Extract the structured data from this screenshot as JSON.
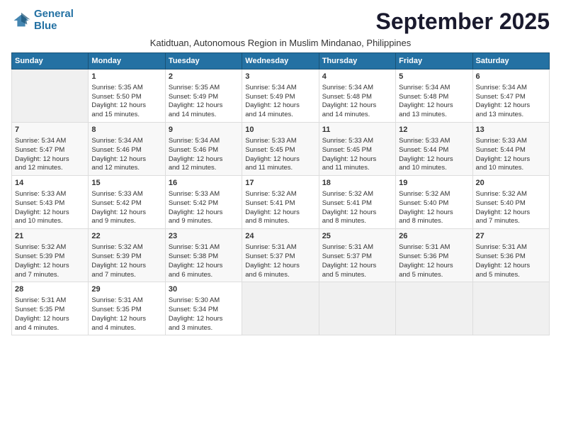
{
  "logo": {
    "line1": "General",
    "line2": "Blue"
  },
  "title": "September 2025",
  "subtitle": "Katidtuan, Autonomous Region in Muslim Mindanao, Philippines",
  "days_header": [
    "Sunday",
    "Monday",
    "Tuesday",
    "Wednesday",
    "Thursday",
    "Friday",
    "Saturday"
  ],
  "weeks": [
    [
      {
        "num": "",
        "info": ""
      },
      {
        "num": "1",
        "info": "Sunrise: 5:35 AM\nSunset: 5:50 PM\nDaylight: 12 hours\nand 15 minutes."
      },
      {
        "num": "2",
        "info": "Sunrise: 5:35 AM\nSunset: 5:49 PM\nDaylight: 12 hours\nand 14 minutes."
      },
      {
        "num": "3",
        "info": "Sunrise: 5:34 AM\nSunset: 5:49 PM\nDaylight: 12 hours\nand 14 minutes."
      },
      {
        "num": "4",
        "info": "Sunrise: 5:34 AM\nSunset: 5:48 PM\nDaylight: 12 hours\nand 14 minutes."
      },
      {
        "num": "5",
        "info": "Sunrise: 5:34 AM\nSunset: 5:48 PM\nDaylight: 12 hours\nand 13 minutes."
      },
      {
        "num": "6",
        "info": "Sunrise: 5:34 AM\nSunset: 5:47 PM\nDaylight: 12 hours\nand 13 minutes."
      }
    ],
    [
      {
        "num": "7",
        "info": "Sunrise: 5:34 AM\nSunset: 5:47 PM\nDaylight: 12 hours\nand 12 minutes."
      },
      {
        "num": "8",
        "info": "Sunrise: 5:34 AM\nSunset: 5:46 PM\nDaylight: 12 hours\nand 12 minutes."
      },
      {
        "num": "9",
        "info": "Sunrise: 5:34 AM\nSunset: 5:46 PM\nDaylight: 12 hours\nand 12 minutes."
      },
      {
        "num": "10",
        "info": "Sunrise: 5:33 AM\nSunset: 5:45 PM\nDaylight: 12 hours\nand 11 minutes."
      },
      {
        "num": "11",
        "info": "Sunrise: 5:33 AM\nSunset: 5:45 PM\nDaylight: 12 hours\nand 11 minutes."
      },
      {
        "num": "12",
        "info": "Sunrise: 5:33 AM\nSunset: 5:44 PM\nDaylight: 12 hours\nand 10 minutes."
      },
      {
        "num": "13",
        "info": "Sunrise: 5:33 AM\nSunset: 5:44 PM\nDaylight: 12 hours\nand 10 minutes."
      }
    ],
    [
      {
        "num": "14",
        "info": "Sunrise: 5:33 AM\nSunset: 5:43 PM\nDaylight: 12 hours\nand 10 minutes."
      },
      {
        "num": "15",
        "info": "Sunrise: 5:33 AM\nSunset: 5:42 PM\nDaylight: 12 hours\nand 9 minutes."
      },
      {
        "num": "16",
        "info": "Sunrise: 5:33 AM\nSunset: 5:42 PM\nDaylight: 12 hours\nand 9 minutes."
      },
      {
        "num": "17",
        "info": "Sunrise: 5:32 AM\nSunset: 5:41 PM\nDaylight: 12 hours\nand 8 minutes."
      },
      {
        "num": "18",
        "info": "Sunrise: 5:32 AM\nSunset: 5:41 PM\nDaylight: 12 hours\nand 8 minutes."
      },
      {
        "num": "19",
        "info": "Sunrise: 5:32 AM\nSunset: 5:40 PM\nDaylight: 12 hours\nand 8 minutes."
      },
      {
        "num": "20",
        "info": "Sunrise: 5:32 AM\nSunset: 5:40 PM\nDaylight: 12 hours\nand 7 minutes."
      }
    ],
    [
      {
        "num": "21",
        "info": "Sunrise: 5:32 AM\nSunset: 5:39 PM\nDaylight: 12 hours\nand 7 minutes."
      },
      {
        "num": "22",
        "info": "Sunrise: 5:32 AM\nSunset: 5:39 PM\nDaylight: 12 hours\nand 7 minutes."
      },
      {
        "num": "23",
        "info": "Sunrise: 5:31 AM\nSunset: 5:38 PM\nDaylight: 12 hours\nand 6 minutes."
      },
      {
        "num": "24",
        "info": "Sunrise: 5:31 AM\nSunset: 5:37 PM\nDaylight: 12 hours\nand 6 minutes."
      },
      {
        "num": "25",
        "info": "Sunrise: 5:31 AM\nSunset: 5:37 PM\nDaylight: 12 hours\nand 5 minutes."
      },
      {
        "num": "26",
        "info": "Sunrise: 5:31 AM\nSunset: 5:36 PM\nDaylight: 12 hours\nand 5 minutes."
      },
      {
        "num": "27",
        "info": "Sunrise: 5:31 AM\nSunset: 5:36 PM\nDaylight: 12 hours\nand 5 minutes."
      }
    ],
    [
      {
        "num": "28",
        "info": "Sunrise: 5:31 AM\nSunset: 5:35 PM\nDaylight: 12 hours\nand 4 minutes."
      },
      {
        "num": "29",
        "info": "Sunrise: 5:31 AM\nSunset: 5:35 PM\nDaylight: 12 hours\nand 4 minutes."
      },
      {
        "num": "30",
        "info": "Sunrise: 5:30 AM\nSunset: 5:34 PM\nDaylight: 12 hours\nand 3 minutes."
      },
      {
        "num": "",
        "info": ""
      },
      {
        "num": "",
        "info": ""
      },
      {
        "num": "",
        "info": ""
      },
      {
        "num": "",
        "info": ""
      }
    ]
  ]
}
